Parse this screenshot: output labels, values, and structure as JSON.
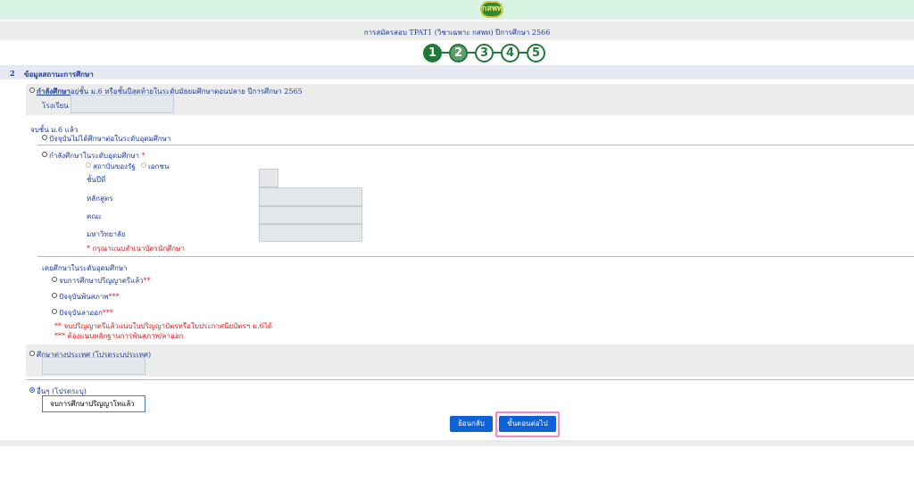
{
  "header": {
    "logo_text": "กสพท",
    "subtitle": "การสมัครสอบ TPAT1 (วิชาเฉพาะ กสพท) ปีการศึกษา 2566"
  },
  "stepper": {
    "steps": [
      "1",
      "2",
      "3",
      "4",
      "5"
    ],
    "current": 2
  },
  "section": {
    "number": "2",
    "title": "ข้อมูลสถานะการศึกษา"
  },
  "option_studying": {
    "label_link": "กำลังศึกษา",
    "label_rest": "อยู่ชั้น ม.6 หรือชั้นปีสุดท้ายในระดับมัธยมศึกษาตอนปลาย ปีการศึกษา 2565",
    "school_label": "โรงเรียน"
  },
  "graduated": {
    "heading": "จบชั้น ม.6 แล้ว",
    "not_studying": "ปัจจุบันไม่ได้ศึกษาต่อในระดับอุดมศึกษา",
    "studying_higher": "กำลังศึกษาในระดับอุดมศึกษา",
    "required_mark": "*",
    "public_label": "สถาบันของรัฐ",
    "private_label": "เอกชน",
    "year_label": "ชั้นปีที่",
    "program_label": "หลักสูตร",
    "faculty_label": "คณะ",
    "university_label": "มหาวิทยาลัย",
    "attach_note": "* กรุณาแนบสำเนาบัตรนักศึกษา"
  },
  "previously": {
    "heading": "เคยศึกษาในระดับอุดมศึกษา",
    "completed": "จบการศึกษาปริญญาตรีแล้ว",
    "completed_mark": "**",
    "retired": "ปัจจุบันพ้นสภาพ",
    "retired_mark": "***",
    "resigned": "ปัจจุบันลาออก",
    "resigned_mark": "***",
    "note1": "** จบปริญญาตรีแล้วแนบใบปริญญาบัตรหรือใบประกาศนียบัตรฯ ม.6ได้",
    "note2": "*** ต้องแนบหลักฐานการพ้นสภาพ/ลาออก"
  },
  "abroad": {
    "label": "ศึกษาต่างประเทศ (โปรดระบุประเทศ)"
  },
  "other": {
    "label": "อื่นๆ (โปรดระบุ)",
    "value": "จบการศึกษาปริญญาโทแล้ว"
  },
  "actions": {
    "back_label": "ย้อนกลับ",
    "next_label": "ขั้นตอนต่อไป"
  },
  "colors": {
    "text_blue": "#1a3da6",
    "step_green": "#1f7a3a",
    "button_blue": "#0e62d6",
    "required_red": "#e0191e"
  }
}
